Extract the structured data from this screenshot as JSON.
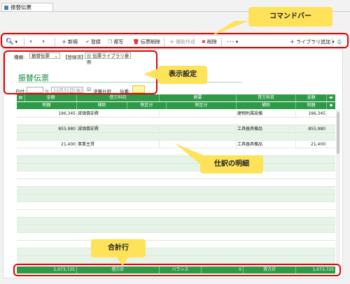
{
  "tab": {
    "label": "振替伝票"
  },
  "toolbar": {
    "new": "新規",
    "register": "登録",
    "copy": "複写",
    "delete_slip": "伝票削除",
    "supplement": "補助作成",
    "delete": "削除",
    "more": "･･･",
    "library_add": "ライブラリ追加"
  },
  "settings": {
    "kind_label": "種類:",
    "kind_value": "振替伝票",
    "status": "【登録済】",
    "library_ref": "伝票ライブラリ参照",
    "title": "振替伝票",
    "date_label": "日付:",
    "date_era": "年",
    "date_value": "12月31日(水)",
    "closing_check": "決算仕訳",
    "slip_no_label": "伝番:"
  },
  "headers": {
    "row1": [
      "金額",
      "借方科目",
      "摘要",
      "貸方科目",
      "金額"
    ],
    "row2": [
      "税額",
      "補助",
      "税区分",
      "税区分",
      "補助",
      "税額"
    ]
  },
  "rows": [
    {
      "amount_l": "196,345",
      "debit": "減価償却費",
      "credit": "建物附属設備",
      "amount_r": "196,345"
    },
    {
      "amount_l": "855,980",
      "debit": "減価償却費",
      "credit": "工具器具備品",
      "amount_r": "855,980"
    },
    {
      "amount_l": "21,400",
      "debit": "事業主貸",
      "credit": "工具器具備品",
      "amount_r": "21,400"
    }
  ],
  "footer": {
    "debit_total": "1,073,725",
    "debit_label": "借方計",
    "balance_label": "バランス",
    "balance_value": "0",
    "credit_label": "貸方計",
    "credit_total": "1,073,725"
  },
  "callouts": {
    "command_bar": "コマンドバー",
    "display_settings": "表示設定",
    "journal_details": "仕訳の明細",
    "total_row": "合計行"
  },
  "colors": {
    "accent_green": "#2e9a48",
    "callout_yellow": "#fde25a",
    "highlight_red": "#e30000"
  }
}
